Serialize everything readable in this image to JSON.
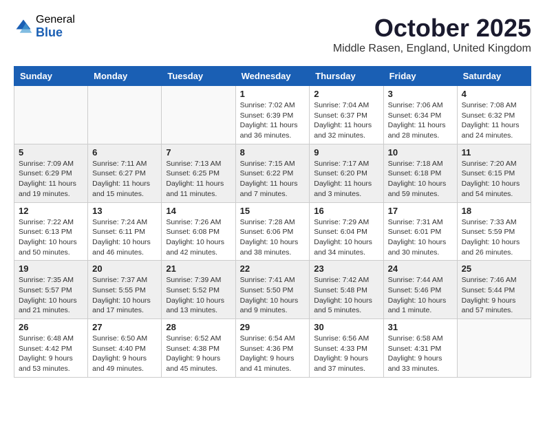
{
  "logo": {
    "general": "General",
    "blue": "Blue"
  },
  "title": "October 2025",
  "location": "Middle Rasen, England, United Kingdom",
  "headers": [
    "Sunday",
    "Monday",
    "Tuesday",
    "Wednesday",
    "Thursday",
    "Friday",
    "Saturday"
  ],
  "weeks": [
    [
      {
        "day": "",
        "info": ""
      },
      {
        "day": "",
        "info": ""
      },
      {
        "day": "",
        "info": ""
      },
      {
        "day": "1",
        "info": "Sunrise: 7:02 AM\nSunset: 6:39 PM\nDaylight: 11 hours and 36 minutes."
      },
      {
        "day": "2",
        "info": "Sunrise: 7:04 AM\nSunset: 6:37 PM\nDaylight: 11 hours and 32 minutes."
      },
      {
        "day": "3",
        "info": "Sunrise: 7:06 AM\nSunset: 6:34 PM\nDaylight: 11 hours and 28 minutes."
      },
      {
        "day": "4",
        "info": "Sunrise: 7:08 AM\nSunset: 6:32 PM\nDaylight: 11 hours and 24 minutes."
      }
    ],
    [
      {
        "day": "5",
        "info": "Sunrise: 7:09 AM\nSunset: 6:29 PM\nDaylight: 11 hours and 19 minutes."
      },
      {
        "day": "6",
        "info": "Sunrise: 7:11 AM\nSunset: 6:27 PM\nDaylight: 11 hours and 15 minutes."
      },
      {
        "day": "7",
        "info": "Sunrise: 7:13 AM\nSunset: 6:25 PM\nDaylight: 11 hours and 11 minutes."
      },
      {
        "day": "8",
        "info": "Sunrise: 7:15 AM\nSunset: 6:22 PM\nDaylight: 11 hours and 7 minutes."
      },
      {
        "day": "9",
        "info": "Sunrise: 7:17 AM\nSunset: 6:20 PM\nDaylight: 11 hours and 3 minutes."
      },
      {
        "day": "10",
        "info": "Sunrise: 7:18 AM\nSunset: 6:18 PM\nDaylight: 10 hours and 59 minutes."
      },
      {
        "day": "11",
        "info": "Sunrise: 7:20 AM\nSunset: 6:15 PM\nDaylight: 10 hours and 54 minutes."
      }
    ],
    [
      {
        "day": "12",
        "info": "Sunrise: 7:22 AM\nSunset: 6:13 PM\nDaylight: 10 hours and 50 minutes."
      },
      {
        "day": "13",
        "info": "Sunrise: 7:24 AM\nSunset: 6:11 PM\nDaylight: 10 hours and 46 minutes."
      },
      {
        "day": "14",
        "info": "Sunrise: 7:26 AM\nSunset: 6:08 PM\nDaylight: 10 hours and 42 minutes."
      },
      {
        "day": "15",
        "info": "Sunrise: 7:28 AM\nSunset: 6:06 PM\nDaylight: 10 hours and 38 minutes."
      },
      {
        "day": "16",
        "info": "Sunrise: 7:29 AM\nSunset: 6:04 PM\nDaylight: 10 hours and 34 minutes."
      },
      {
        "day": "17",
        "info": "Sunrise: 7:31 AM\nSunset: 6:01 PM\nDaylight: 10 hours and 30 minutes."
      },
      {
        "day": "18",
        "info": "Sunrise: 7:33 AM\nSunset: 5:59 PM\nDaylight: 10 hours and 26 minutes."
      }
    ],
    [
      {
        "day": "19",
        "info": "Sunrise: 7:35 AM\nSunset: 5:57 PM\nDaylight: 10 hours and 21 minutes."
      },
      {
        "day": "20",
        "info": "Sunrise: 7:37 AM\nSunset: 5:55 PM\nDaylight: 10 hours and 17 minutes."
      },
      {
        "day": "21",
        "info": "Sunrise: 7:39 AM\nSunset: 5:52 PM\nDaylight: 10 hours and 13 minutes."
      },
      {
        "day": "22",
        "info": "Sunrise: 7:41 AM\nSunset: 5:50 PM\nDaylight: 10 hours and 9 minutes."
      },
      {
        "day": "23",
        "info": "Sunrise: 7:42 AM\nSunset: 5:48 PM\nDaylight: 10 hours and 5 minutes."
      },
      {
        "day": "24",
        "info": "Sunrise: 7:44 AM\nSunset: 5:46 PM\nDaylight: 10 hours and 1 minute."
      },
      {
        "day": "25",
        "info": "Sunrise: 7:46 AM\nSunset: 5:44 PM\nDaylight: 9 hours and 57 minutes."
      }
    ],
    [
      {
        "day": "26",
        "info": "Sunrise: 6:48 AM\nSunset: 4:42 PM\nDaylight: 9 hours and 53 minutes."
      },
      {
        "day": "27",
        "info": "Sunrise: 6:50 AM\nSunset: 4:40 PM\nDaylight: 9 hours and 49 minutes."
      },
      {
        "day": "28",
        "info": "Sunrise: 6:52 AM\nSunset: 4:38 PM\nDaylight: 9 hours and 45 minutes."
      },
      {
        "day": "29",
        "info": "Sunrise: 6:54 AM\nSunset: 4:36 PM\nDaylight: 9 hours and 41 minutes."
      },
      {
        "day": "30",
        "info": "Sunrise: 6:56 AM\nSunset: 4:33 PM\nDaylight: 9 hours and 37 minutes."
      },
      {
        "day": "31",
        "info": "Sunrise: 6:58 AM\nSunset: 4:31 PM\nDaylight: 9 hours and 33 minutes."
      },
      {
        "day": "",
        "info": ""
      }
    ]
  ]
}
